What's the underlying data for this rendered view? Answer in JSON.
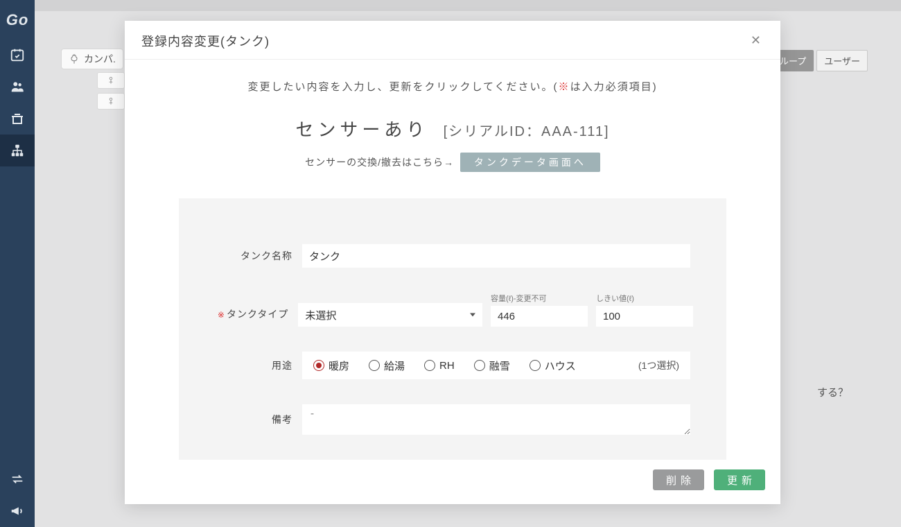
{
  "sidebar": {
    "logo": "Go"
  },
  "background": {
    "crumb": "カンパ.",
    "tab_group": "グループ",
    "tab_user": "ユーザー",
    "question_tail": "する？"
  },
  "modal": {
    "title": "登録内容変更(タンク)",
    "instruction_pre": "変更したい内容を入力し、更新をクリックしてください。(",
    "instruction_mark": "※",
    "instruction_post": "は入力必須項目)",
    "sensor_status": "センサーあり",
    "serial_label": "[シリアルID：AAA-111]",
    "exchange_text": "センサーの交換/撤去はこちら→",
    "tank_data_link": "タンクデータ画面へ",
    "form": {
      "tank_name_label": "タンク名称",
      "tank_name_value": "タンク",
      "tank_type_label": "タンクタイプ",
      "tank_type_value": "未選択",
      "capacity_label": "容量(ℓ)-変更不可",
      "capacity_value": "446",
      "threshold_label": "しきい値(ℓ)",
      "threshold_value": "100",
      "usage_label": "用途",
      "usage_options": {
        "heating": "暖房",
        "hotwater": "給湯",
        "rh": "RH",
        "snowmelt": "融雪",
        "house": "ハウス"
      },
      "usage_hint": "(1つ選択)",
      "remarks_label": "備考",
      "remarks_value": "-"
    },
    "buttons": {
      "delete": "削除",
      "update": "更新"
    }
  }
}
